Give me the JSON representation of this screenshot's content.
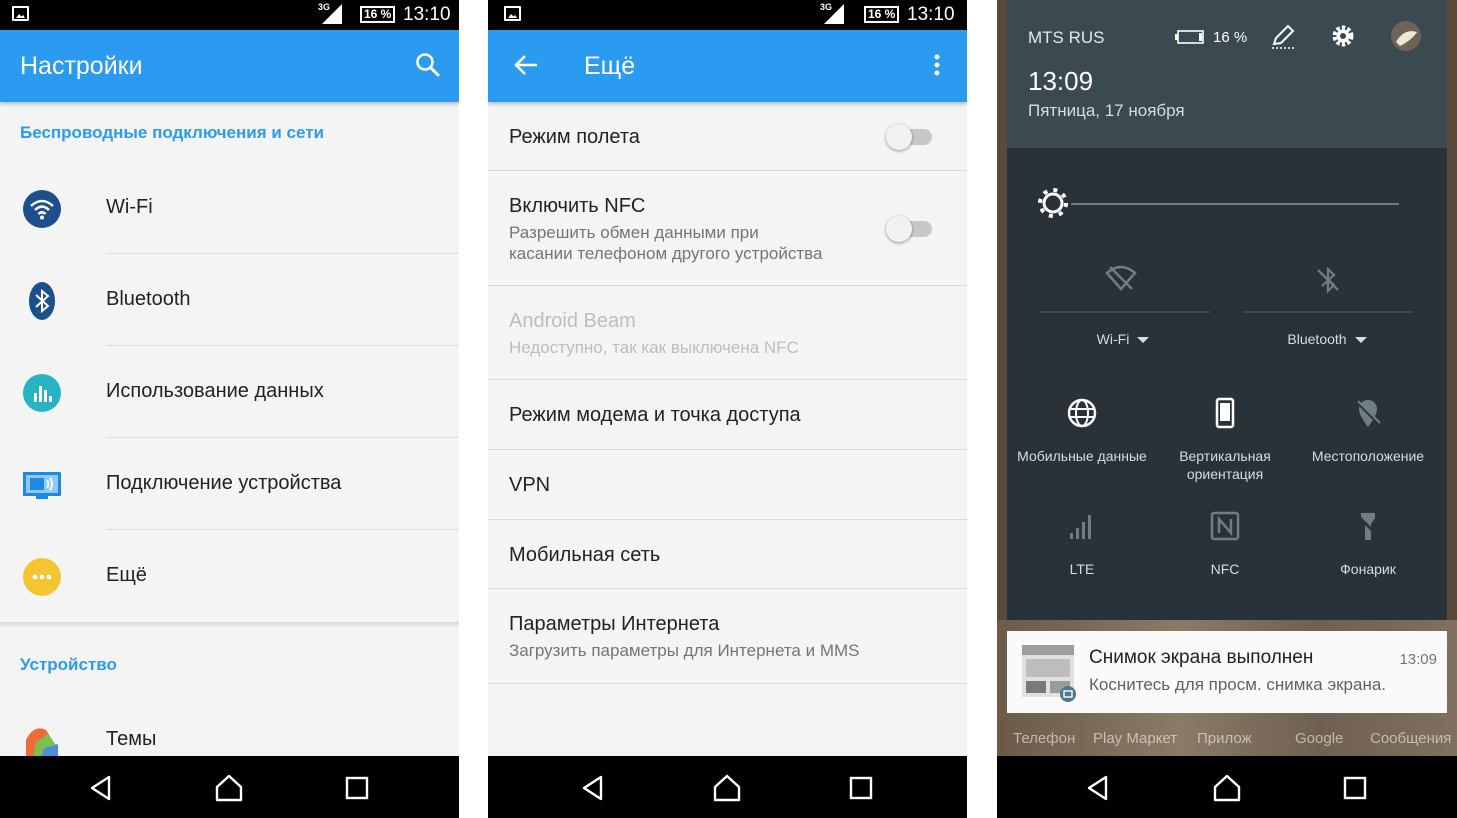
{
  "panel1": {
    "status": {
      "net": "3G",
      "battery": "16 %",
      "time": "13:10"
    },
    "title": "Настройки",
    "sections": [
      {
        "header": "Беспроводные подключения и сети",
        "items": [
          {
            "label": "Wi-Fi",
            "icon": "wifi-icon",
            "color": "#1c4f8c"
          },
          {
            "label": "Bluetooth",
            "icon": "bluetooth-icon",
            "color": "#1c4f8c"
          },
          {
            "label": "Использование данных",
            "icon": "data-usage-icon",
            "color": "#26b3c4"
          },
          {
            "label": "Подключение устройства",
            "icon": "device-connection-icon",
            "color": "#1e88e5"
          },
          {
            "label": "Ещё",
            "icon": "more-icon",
            "color": "#f4c531"
          }
        ]
      },
      {
        "header": "Устройство",
        "items": [
          {
            "label": "Темы",
            "icon": "themes-icon",
            "color": "#f06a3a"
          }
        ]
      }
    ]
  },
  "panel2": {
    "status": {
      "net": "3G",
      "battery": "16 %",
      "time": "13:10"
    },
    "title": "Ещё",
    "items": [
      {
        "title": "Режим полета",
        "toggle": "off"
      },
      {
        "title": "Включить NFC",
        "subtitle1": "Разрешить обмен данными при",
        "subtitle2": "касании телефоном другого устройства",
        "toggle": "off"
      },
      {
        "title": "Android Beam",
        "subtitle1": "Недоступно, так как выключена NFC",
        "disabled": true
      },
      {
        "title": "Режим модема и точка доступа"
      },
      {
        "title": "VPN"
      },
      {
        "title": "Мобильная сеть"
      },
      {
        "title": "Параметры Интернета",
        "subtitle1": "Загрузить параметры для Интернета и MMS"
      }
    ]
  },
  "panel3": {
    "carrier": "MTS RUS",
    "battery": "16 %",
    "time": "13:09",
    "date": "Пятница, 17 ноября",
    "brightness": 0.0,
    "tiles_top": [
      {
        "label": "Wi-Fi",
        "icon": "wifi-off-icon"
      },
      {
        "label": "Bluetooth",
        "icon": "bluetooth-off-icon"
      }
    ],
    "tiles": [
      {
        "label": "Мобильные данные",
        "icon": "globe-icon"
      },
      {
        "label": "Вертикальная ориентация",
        "icon": "phone-portrait-icon"
      },
      {
        "label": "Местоположение",
        "icon": "location-off-icon"
      },
      {
        "label": "LTE",
        "icon": "signal-bars-icon"
      },
      {
        "label": "NFC",
        "icon": "nfc-icon"
      },
      {
        "label": "Фонарик",
        "icon": "flashlight-off-icon"
      }
    ],
    "notification": {
      "title": "Снимок экрана выполнен",
      "time": "13:09",
      "text": "Коснитесь для просм. снимка экрана."
    },
    "dock": [
      "Телефон",
      "Play Маркет",
      "Прилож",
      "Google",
      "Сообщения"
    ]
  }
}
